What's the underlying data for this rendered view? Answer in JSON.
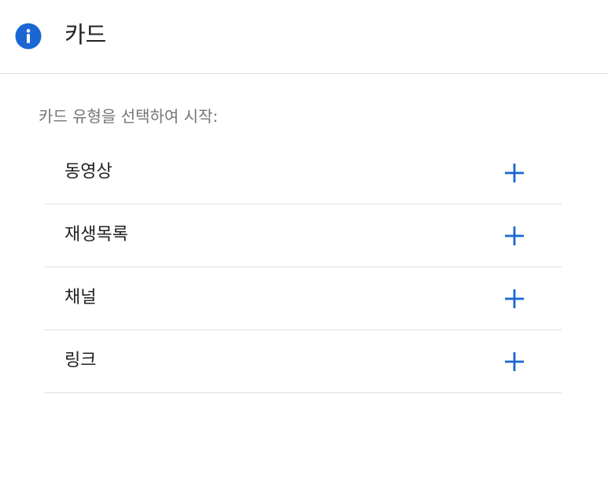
{
  "header": {
    "title": "카드",
    "icon": "info-icon",
    "icon_color": "#1a66d2"
  },
  "prompt": "카드 유형을 선택하여 시작:",
  "card_types": [
    {
      "label": "동영상",
      "action_icon": "plus-icon"
    },
    {
      "label": "재생목록",
      "action_icon": "plus-icon"
    },
    {
      "label": "채널",
      "action_icon": "plus-icon"
    },
    {
      "label": "링크",
      "action_icon": "plus-icon"
    }
  ],
  "colors": {
    "accent": "#1a66d2",
    "text": "#212121",
    "muted": "#757575",
    "divider": "#e0e0e0"
  }
}
